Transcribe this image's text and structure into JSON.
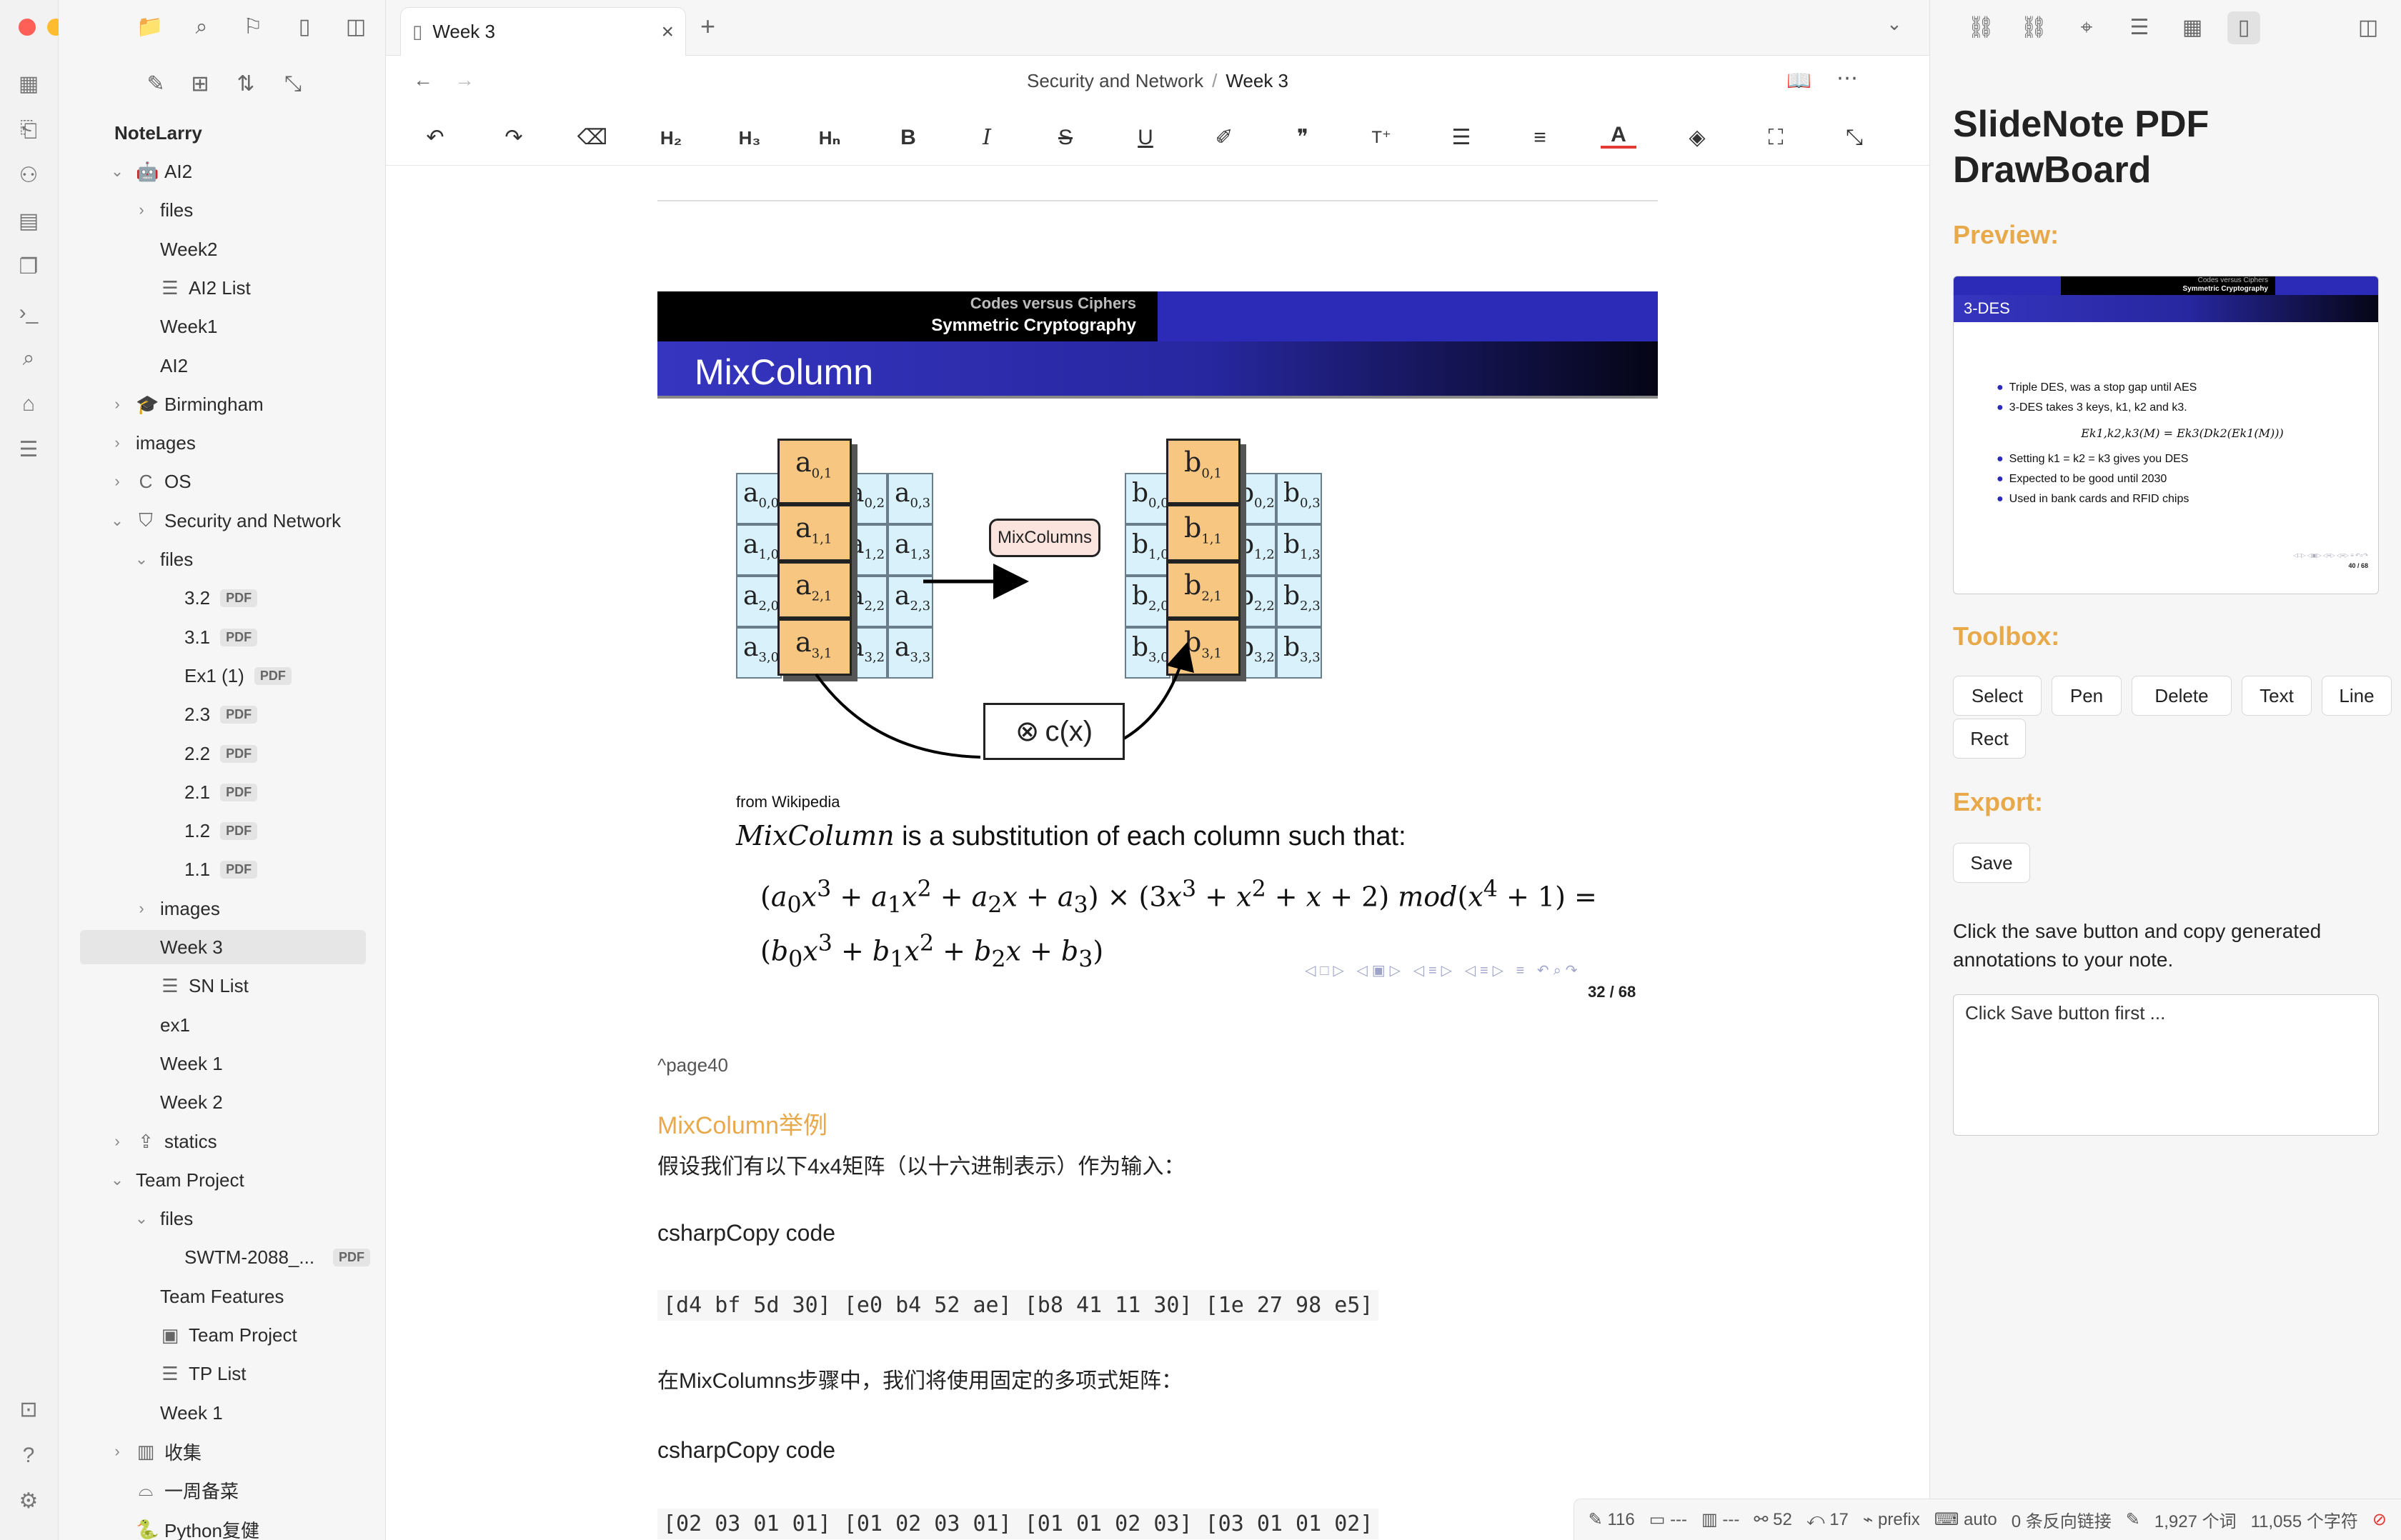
{
  "sidebar": {
    "vault_name": "NoteLarry",
    "items": [
      {
        "label": "AI2",
        "depth": 0,
        "type": "folder-open",
        "icon": "robot-icon"
      },
      {
        "label": "files",
        "depth": 1,
        "type": "folder-closed"
      },
      {
        "label": "Week2",
        "depth": 1,
        "type": "file"
      },
      {
        "label": "AI2 List",
        "depth": 1,
        "type": "list"
      },
      {
        "label": "Week1",
        "depth": 1,
        "type": "file"
      },
      {
        "label": "AI2",
        "depth": 1,
        "type": "file"
      },
      {
        "label": "Birmingham",
        "depth": 0,
        "type": "folder-closed",
        "icon": "graduation-cap-icon"
      },
      {
        "label": "images",
        "depth": 0,
        "type": "folder-closed"
      },
      {
        "label": "OS",
        "depth": 0,
        "type": "folder-closed",
        "icon": "c-icon"
      },
      {
        "label": "Security and Network",
        "depth": 0,
        "type": "folder-open",
        "icon": "shield-icon"
      },
      {
        "label": "files",
        "depth": 1,
        "type": "folder-open"
      },
      {
        "label": "3.2",
        "depth": 2,
        "type": "pdf"
      },
      {
        "label": "3.1",
        "depth": 2,
        "type": "pdf"
      },
      {
        "label": "Ex1 (1)",
        "depth": 2,
        "type": "pdf"
      },
      {
        "label": "2.3",
        "depth": 2,
        "type": "pdf"
      },
      {
        "label": "2.2",
        "depth": 2,
        "type": "pdf"
      },
      {
        "label": "2.1",
        "depth": 2,
        "type": "pdf"
      },
      {
        "label": "1.2",
        "depth": 2,
        "type": "pdf"
      },
      {
        "label": "1.1",
        "depth": 2,
        "type": "pdf"
      },
      {
        "label": "images",
        "depth": 1,
        "type": "folder-closed"
      },
      {
        "label": "Week 3",
        "depth": 1,
        "type": "file",
        "active": true
      },
      {
        "label": "SN List",
        "depth": 1,
        "type": "list"
      },
      {
        "label": "ex1",
        "depth": 1,
        "type": "file"
      },
      {
        "label": "Week 1",
        "depth": 1,
        "type": "file"
      },
      {
        "label": "Week 2",
        "depth": 1,
        "type": "file"
      },
      {
        "label": "statics",
        "depth": 0,
        "type": "folder-closed",
        "icon": "upload-box-icon"
      },
      {
        "label": "Team Project",
        "depth": 0,
        "type": "folder-open"
      },
      {
        "label": "files",
        "depth": 1,
        "type": "folder-open"
      },
      {
        "label": "SWTM-2088_...",
        "depth": 2,
        "type": "pdf"
      },
      {
        "label": "Team Features",
        "depth": 1,
        "type": "file"
      },
      {
        "label": "Team Project",
        "depth": 1,
        "type": "board"
      },
      {
        "label": "TP List",
        "depth": 1,
        "type": "list"
      },
      {
        "label": "Week 1",
        "depth": 1,
        "type": "file"
      },
      {
        "label": "收集",
        "depth": 0,
        "type": "folder-closed",
        "icon": "columns-icon"
      },
      {
        "label": "一周备菜",
        "depth": 0,
        "type": "file",
        "icon": "cloche-icon"
      },
      {
        "label": "Python复健",
        "depth": 0,
        "type": "file",
        "icon": "python-icon"
      }
    ],
    "pdf_badge": "PDF"
  },
  "tab": {
    "title": "Week 3"
  },
  "breadcrumb": {
    "parent": "Security and Network",
    "sep": "/",
    "current": "Week 3"
  },
  "slide": {
    "header_sub": "Codes versus Ciphers",
    "header_main": "Symmetric Cryptography",
    "title": "MixColumn",
    "mixcolumns_label": "MixColumns",
    "cx_label": "c(x)",
    "a_cells": [
      [
        "a0,0",
        "a0,2",
        "a0,3"
      ],
      [
        "a1,0",
        "a1,2",
        "a1,3"
      ],
      [
        "a2,0",
        "a2,2",
        "a2,3"
      ],
      [
        "a3,0",
        "a3,2",
        "a3,3"
      ]
    ],
    "a_col": [
      "a0,1",
      "a1,1",
      "a2,1",
      "a3,1"
    ],
    "b_cells": [
      [
        "b0,0",
        "b0,2",
        "b0,3"
      ],
      [
        "b1,0",
        "b1,2",
        "b1,3"
      ],
      [
        "b2,0",
        "b2,2",
        "b2,3"
      ],
      [
        "b3,0",
        "b3,2",
        "b3,3"
      ]
    ],
    "b_col": [
      "b0,1",
      "b1,1",
      "b2,1",
      "b3,1"
    ],
    "source": "from Wikipedia",
    "desc_italic": "MixColumn",
    "desc_rest": " is a substitution of each column such that:",
    "page_num": "32 / 68"
  },
  "content": {
    "anchor": "^page40",
    "heading": "MixColumn举例",
    "para1": "假设我们有以下4x4矩阵（以十六进制表示）作为输入：",
    "code_label1": "csharpCopy code",
    "code1": "[d4 bf 5d 30] [e0 b4 52 ae] [b8 41 11 30] [1e 27 98 e5]",
    "para2": "在MixColumns步骤中，我们将使用固定的多项式矩阵：",
    "code_label2": "csharpCopy code",
    "code2": "[02 03 01 01] [01 02 03 01] [01 01 02 03] [03 01 01 02]"
  },
  "right_panel": {
    "title": "SlideNote PDF DrawBoard",
    "preview_label": "Preview:",
    "preview": {
      "header_sub": "Codes versus Ciphers",
      "header_main": "Symmetric Cryptography",
      "title": "3-DES",
      "bullets": [
        "Triple DES, was a stop gap until AES",
        "3-DES takes 3 keys, k1, k2 and k3.",
        "Setting k1 = k2 = k3 gives you DES",
        "Expected to be good until 2030",
        "Used in bank cards and RFID chips"
      ],
      "formula": "Ek1,k2,k3(M) = Ek3(Dk2(Ek1(M)))",
      "page": "40 / 68"
    },
    "toolbox_label": "Toolbox:",
    "tools": [
      "Select",
      "Pen",
      "Delete",
      "Text",
      "Line",
      "Rect"
    ],
    "export_label": "Export:",
    "save_label": "Save",
    "instructions": "Click the save button and copy generated annotations to your note.",
    "output_text": "Click Save button first ..."
  },
  "status": {
    "a": "116",
    "b": "---",
    "c": "---",
    "d": "52",
    "e": "17",
    "prefix": "prefix",
    "auto": "auto",
    "backlinks": "0 条反向链接",
    "words": "1,927 个词",
    "chars": "11,055 个字符"
  }
}
